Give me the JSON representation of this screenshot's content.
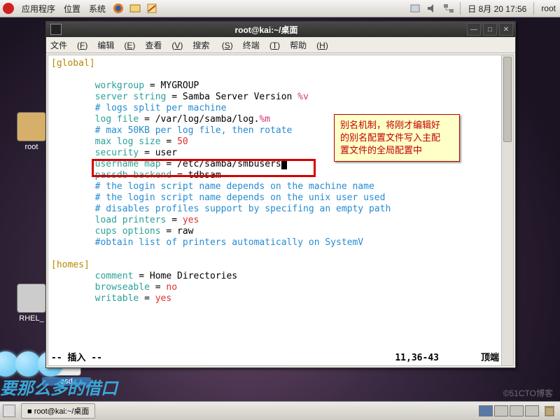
{
  "panel": {
    "menus": [
      "应用程序",
      "位置",
      "系统"
    ],
    "clock": "日  8月 20 17:56",
    "user": "root"
  },
  "desktop_icons": {
    "root": "root",
    "rhel": "RHEL_",
    "asd": "asd"
  },
  "taskbar": {
    "task": "■ root@kai:~/桌面"
  },
  "terminal_window": {
    "title": "root@kai:~/桌面",
    "menus": {
      "file": "文件",
      "edit": "编辑",
      "view": "查看",
      "search": "搜索",
      "terminal": "终端",
      "help": "帮助"
    },
    "mnemonics": {
      "file": "F",
      "edit": "E",
      "view": "V",
      "search": "S",
      "terminal": "T",
      "help": "H"
    },
    "status_mode": "-- 插入 --",
    "status_pos": "11,36-43",
    "status_pct": "顶端"
  },
  "smb": {
    "sect_global": "[global]",
    "l1a": "workgroup",
    "l1b": " = MYGROUP",
    "l2a": "server string",
    "l2b": " = Samba Server Version ",
    "l2c": "%v",
    "l3": "# logs split per machine",
    "l4a": "log file",
    "l4b": " = /var/log/samba/log.",
    "l4c": "%m",
    "l5": "# max 50KB per log file, then rotate",
    "l6a": "max log size",
    "l6b": " = ",
    "l6c": "50",
    "l7a": "security",
    "l7b": " = user",
    "l8a": "username map",
    "l8b": " = /etc/samba/smbusers",
    "l9a": "passdb backend",
    "l9b": " = tdbsam",
    "l10": "# the login script name depends on the machine name",
    "l11": "# the login script name depends on the unix user used",
    "l12": "# disables profiles support by specifing an empty path",
    "l13a": "load printers",
    "l13b": " = ",
    "l13c": "yes",
    "l14a": "cups options",
    "l14b": " = raw",
    "l15": "#obtain list of printers automatically on SystemV",
    "sect_homes": "[homes]",
    "h1a": "comment",
    "h1b": " = Home Directories",
    "h2a": "browseable",
    "h2b": " = ",
    "h2c": "no",
    "h3a": "writable",
    "h3b": " = ",
    "h3c": "yes"
  },
  "callout": {
    "l1": "别名机制，将刚才编辑好",
    "l2": "的别名配置文件写入主配",
    "l3": "置文件的全局配置中"
  },
  "bg": {
    "text": "要那么多的借口",
    "watermark": "©51CTO博客"
  }
}
